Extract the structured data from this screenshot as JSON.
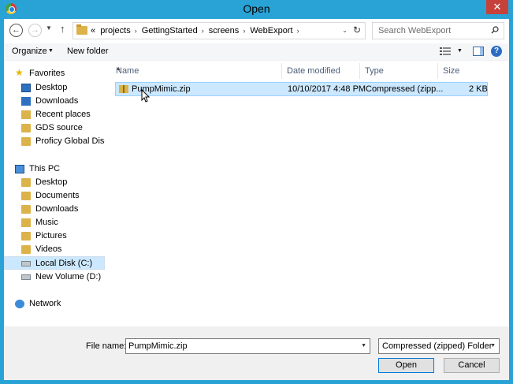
{
  "window": {
    "title": "Open",
    "close_glyph": "✕"
  },
  "nav": {
    "back_glyph": "←",
    "forward_glyph": "→",
    "up_glyph": "↑",
    "recent_glyph": "▼",
    "breadcrumb_prefix": "«",
    "breadcrumb": [
      "projects",
      "GettingStarted",
      "screens",
      "WebExport"
    ],
    "separator": "›",
    "dropdown_glyph": "⌄",
    "refresh_glyph": "↻"
  },
  "search": {
    "placeholder": "Search WebExport"
  },
  "toolbar": {
    "organize_label": "Organize",
    "dropdown_glyph": "▼",
    "new_folder_label": "New folder",
    "help_glyph": "?"
  },
  "sidebar": {
    "favorites_label": "Favorites",
    "favorites": [
      "Desktop",
      "Downloads",
      "Recent places",
      "GDS source",
      "Proficy Global Disco"
    ],
    "this_pc_label": "This PC",
    "this_pc": [
      "Desktop",
      "Documents",
      "Downloads",
      "Music",
      "Pictures",
      "Videos",
      "Local Disk (C:)",
      "New Volume (D:)"
    ],
    "selected": "Local Disk (C:)",
    "network_label": "Network"
  },
  "files": {
    "columns": [
      "Name",
      "Date modified",
      "Type",
      "Size"
    ],
    "sort_glyph": "▲",
    "rows": [
      {
        "name": "PumpMimic.zip",
        "date": "10/10/2017 4:48 PM",
        "type": "Compressed (zipp...",
        "size": "2 KB"
      }
    ]
  },
  "footer": {
    "file_name_label": "File name:",
    "file_name_value": "PumpMimic.zip",
    "file_type_value": "Compressed (zipped) Folder",
    "dropdown_glyph": "▼",
    "open_label": "Open",
    "cancel_label": "Cancel"
  },
  "colors": {
    "titlebar": "#29a3d6",
    "close": "#c7413b",
    "selection": "#cce8ff",
    "folder": "#dcb34a"
  }
}
